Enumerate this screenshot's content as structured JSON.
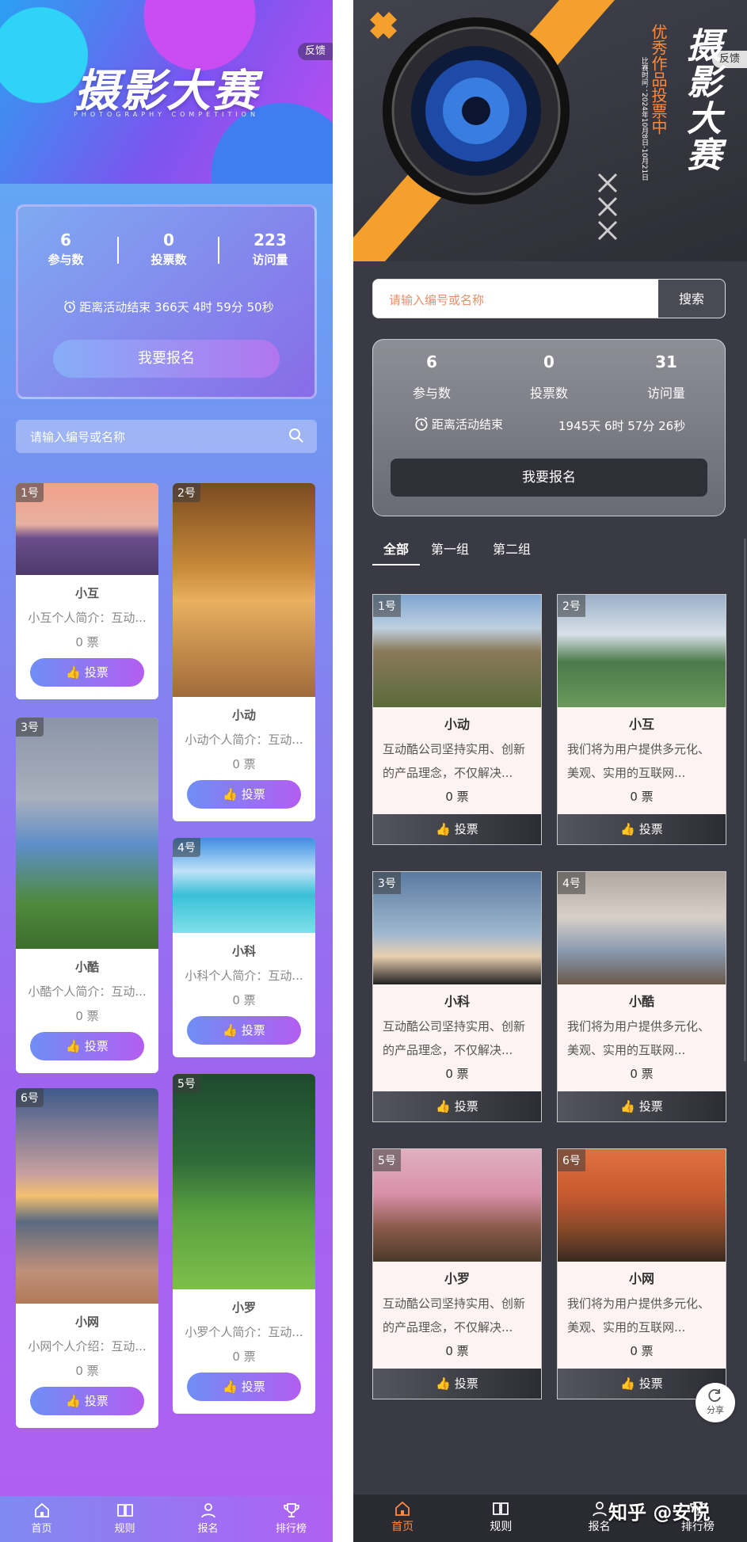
{
  "left": {
    "feedback": "反馈",
    "title": "摄影大赛",
    "subtitle": "PHOTOGRAPHY COMPETITION",
    "stats": [
      {
        "value": "6",
        "label": "参与数"
      },
      {
        "value": "0",
        "label": "投票数"
      },
      {
        "value": "223",
        "label": "访问量"
      }
    ],
    "countdown": "距离活动结束  366天 4时 59分 50秒",
    "signup": "我要报名",
    "search_placeholder": "请输入编号或名称",
    "cards": [
      {
        "num": "1号",
        "name": "小互",
        "desc": "小互个人简介：互动...",
        "votes": "0 票",
        "vote_label": "投票"
      },
      {
        "num": "2号",
        "name": "小动",
        "desc": "小动个人简介：互动...",
        "votes": "0 票",
        "vote_label": "投票"
      },
      {
        "num": "3号",
        "name": "小酷",
        "desc": "小酷个人简介：互动...",
        "votes": "0 票",
        "vote_label": "投票"
      },
      {
        "num": "4号",
        "name": "小科",
        "desc": "小科个人简介：互动...",
        "votes": "0 票",
        "vote_label": "投票"
      },
      {
        "num": "6号",
        "name": "小网",
        "desc": "小网个人介绍：互动...",
        "votes": "0 票",
        "vote_label": "投票"
      },
      {
        "num": "5号",
        "name": "小罗",
        "desc": "小罗个人简介：互动...",
        "votes": "0 票",
        "vote_label": "投票"
      }
    ],
    "tabbar": [
      {
        "icon": "home-icon",
        "label": "首页"
      },
      {
        "icon": "book-icon",
        "label": "规则"
      },
      {
        "icon": "person-icon",
        "label": "报名"
      },
      {
        "icon": "trophy-icon",
        "label": "排行榜"
      }
    ]
  },
  "right": {
    "feedback": "反馈",
    "title_chars": [
      "摄",
      "影",
      "大",
      "赛"
    ],
    "vertical_text": "优秀作品投票中",
    "time_text": "比赛时间：2024年10月8日-10月21日",
    "search_placeholder": "请输入编号或名称",
    "search_button": "搜索",
    "stats": [
      {
        "value": "6",
        "label": "参与数"
      },
      {
        "value": "0",
        "label": "投票数"
      },
      {
        "value": "31",
        "label": "访问量"
      }
    ],
    "countdown_label": "距离活动结束",
    "countdown_value": "1945天 6时 57分 26秒",
    "signup": "我要报名",
    "group_tabs": [
      "全部",
      "第一组",
      "第二组"
    ],
    "cards": [
      {
        "num": "1号",
        "name": "小动",
        "desc": "互动酷公司坚持实用、创新的产品理念，不仅解决...",
        "votes": "0 票",
        "vote_label": "投票"
      },
      {
        "num": "2号",
        "name": "小互",
        "desc": "我们将为用户提供多元化、美观、实用的互联网...",
        "votes": "0 票",
        "vote_label": "投票"
      },
      {
        "num": "3号",
        "name": "小科",
        "desc": "互动酷公司坚持实用、创新的产品理念，不仅解决...",
        "votes": "0 票",
        "vote_label": "投票"
      },
      {
        "num": "4号",
        "name": "小酷",
        "desc": "我们将为用户提供多元化、美观、实用的互联网...",
        "votes": "0 票",
        "vote_label": "投票"
      },
      {
        "num": "5号",
        "name": "小罗",
        "desc": "互动酷公司坚持实用、创新的产品理念，不仅解决...",
        "votes": "0 票",
        "vote_label": "投票"
      },
      {
        "num": "6号",
        "name": "小网",
        "desc": "我们将为用户提供多元化、美观、实用的互联网...",
        "votes": "0 票",
        "vote_label": "投票"
      }
    ],
    "share": "分享",
    "tabbar": [
      {
        "icon": "home-icon",
        "label": "首页"
      },
      {
        "icon": "book-icon",
        "label": "规则"
      },
      {
        "icon": "person-icon",
        "label": "报名"
      },
      {
        "icon": "trophy-icon",
        "label": "排行榜"
      }
    ],
    "watermark": "知乎 @安悦"
  },
  "colors": {
    "left_accent": "#9f64ef",
    "right_accent": "#ff8a3d",
    "right_bg": "#3a3a44"
  }
}
